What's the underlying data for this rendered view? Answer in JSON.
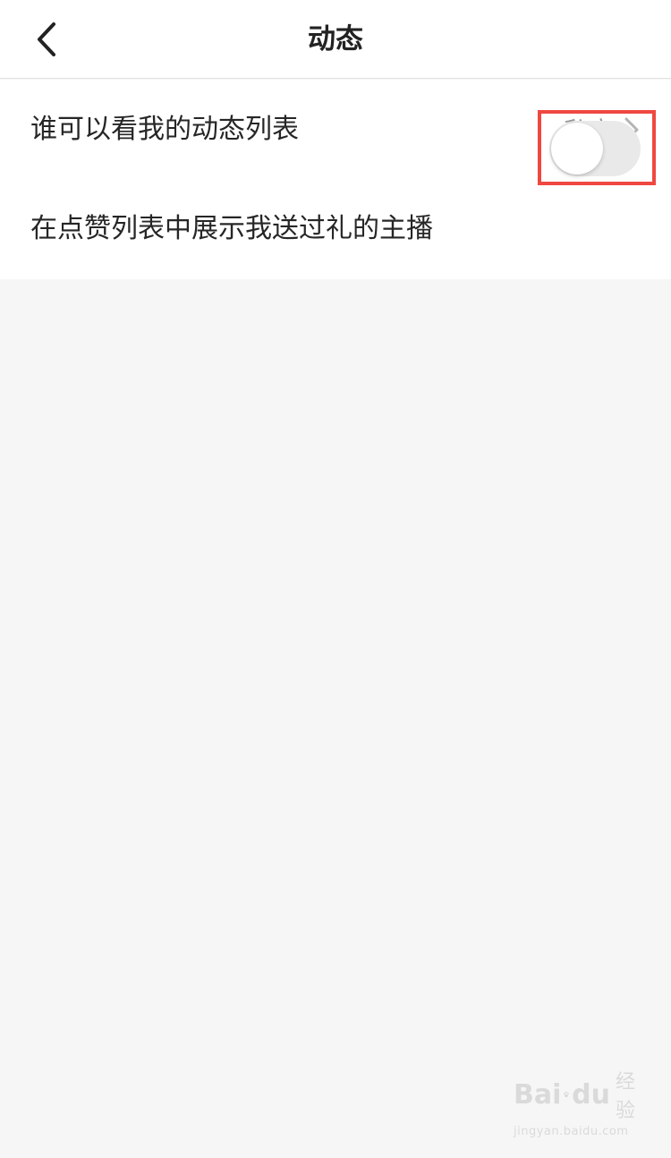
{
  "header": {
    "title": "动态",
    "back_icon": "chevron-left-icon"
  },
  "settings": {
    "rows": [
      {
        "label": "谁可以看我的动态列表",
        "value": "私密",
        "icon": "chevron-right-icon"
      },
      {
        "label": "在点赞列表中展示我送过礼的主播",
        "toggle_on": false
      }
    ]
  },
  "annotation": {
    "highlight_color": "#ef4840"
  },
  "watermark": {
    "brand_left": "Bai",
    "brand_right": "du",
    "brand_cn": "经验",
    "url": "jingyan.baidu.com"
  },
  "colors": {
    "page_background": "#f6f6f6",
    "card_background": "#ffffff",
    "toggle_off": "#e9e9ea"
  }
}
